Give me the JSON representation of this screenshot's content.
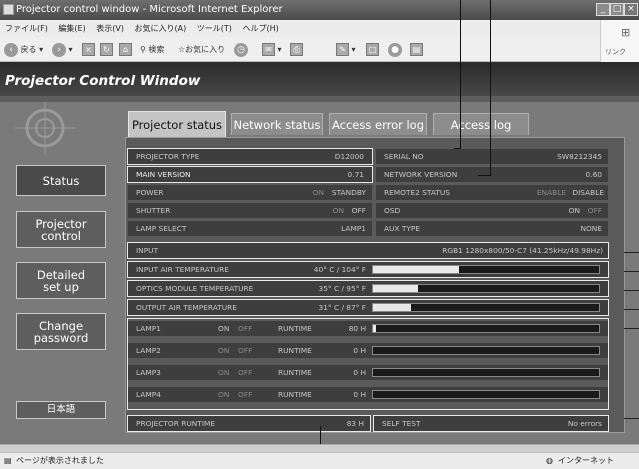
{
  "window": {
    "title": "Projector control window - Microsoft Internet Explorer"
  },
  "menu": [
    "ファイル(F)",
    "編集(E)",
    "表示(V)",
    "お気に入り(A)",
    "ツール(T)",
    "ヘルプ(H)"
  ],
  "toolbar": {
    "back_label": "戻る",
    "search_label": "検索",
    "favorites_label": "お気に入り",
    "link_label": "リンク"
  },
  "header": {
    "title": "Projector Control Window"
  },
  "nav": {
    "status": "Status",
    "projector_control_1": "Projector",
    "projector_control_2": "control",
    "detailed_1": "Detailed",
    "detailed_2": "set up",
    "change_pw_1": "Change",
    "change_pw_2": "password",
    "language": "日本語"
  },
  "tabs": {
    "projector_status": "Projector status",
    "network_status": "Network status",
    "access_error_log": "Access error log",
    "access_log": "Access log"
  },
  "status": {
    "projector_type_label": "PROJECTOR TYPE",
    "projector_type_value": "D12000",
    "serial_no_label": "SERIAL NO",
    "serial_no_value": "SW8212345",
    "main_version_label": "MAIN VERSION",
    "main_version_value": "0.71",
    "network_version_label": "NETWORK VERSION",
    "network_version_value": "0.60",
    "power_label": "POWER",
    "power_on": "ON",
    "power_standby": "STANDBY",
    "remote2_label": "REMOTE2 STATUS",
    "remote2_enable": "ENABLE",
    "remote2_disable": "DISABLE",
    "shutter_label": "SHUTTER",
    "shutter_on": "ON",
    "shutter_off": "OFF",
    "osd_label": "OSD",
    "osd_on": "ON",
    "osd_off": "OFF",
    "lamp_select_label": "LAMP SELECT",
    "lamp_select_value": "LAMP1",
    "aux_type_label": "AUX TYPE",
    "aux_type_value": "NONE",
    "input_label": "INPUT",
    "input_value": "RGB1  1280x800/50-C7 (41.25kHz/49.98Hz)",
    "input_air_label": "INPUT AIR TEMPERATURE",
    "input_air_value": "40° C / 104° F",
    "input_air_level": 0.38,
    "optics_label": "OPTICS MODULE TEMPERATURE",
    "optics_value": "35° C / 95° F",
    "optics_level": 0.2,
    "output_air_label": "OUTPUT AIR TEMPERATURE",
    "output_air_value": "31° C / 87° F",
    "output_air_level": 0.17,
    "lamps": [
      {
        "name": "LAMP1",
        "on": "ON",
        "off": "OFF",
        "runtime_label": "RUNTIME",
        "runtime": "80 H",
        "level": 0.015
      },
      {
        "name": "LAMP2",
        "on": "ON",
        "off": "OFF",
        "runtime_label": "RUNTIME",
        "runtime": "0 H",
        "level": 0
      },
      {
        "name": "LAMP3",
        "on": "ON",
        "off": "OFF",
        "runtime_label": "RUNTIME",
        "runtime": "0 H",
        "level": 0
      },
      {
        "name": "LAMP4",
        "on": "ON",
        "off": "OFF",
        "runtime_label": "RUNTIME",
        "runtime": "0 H",
        "level": 0
      }
    ],
    "projector_runtime_label": "PROJECTOR RUNTIME",
    "projector_runtime_value": "83 H",
    "self_test_label": "SELF TEST",
    "self_test_value": "No errors"
  },
  "statusbar": {
    "left": "ページが表示されました",
    "right": "インターネット"
  }
}
